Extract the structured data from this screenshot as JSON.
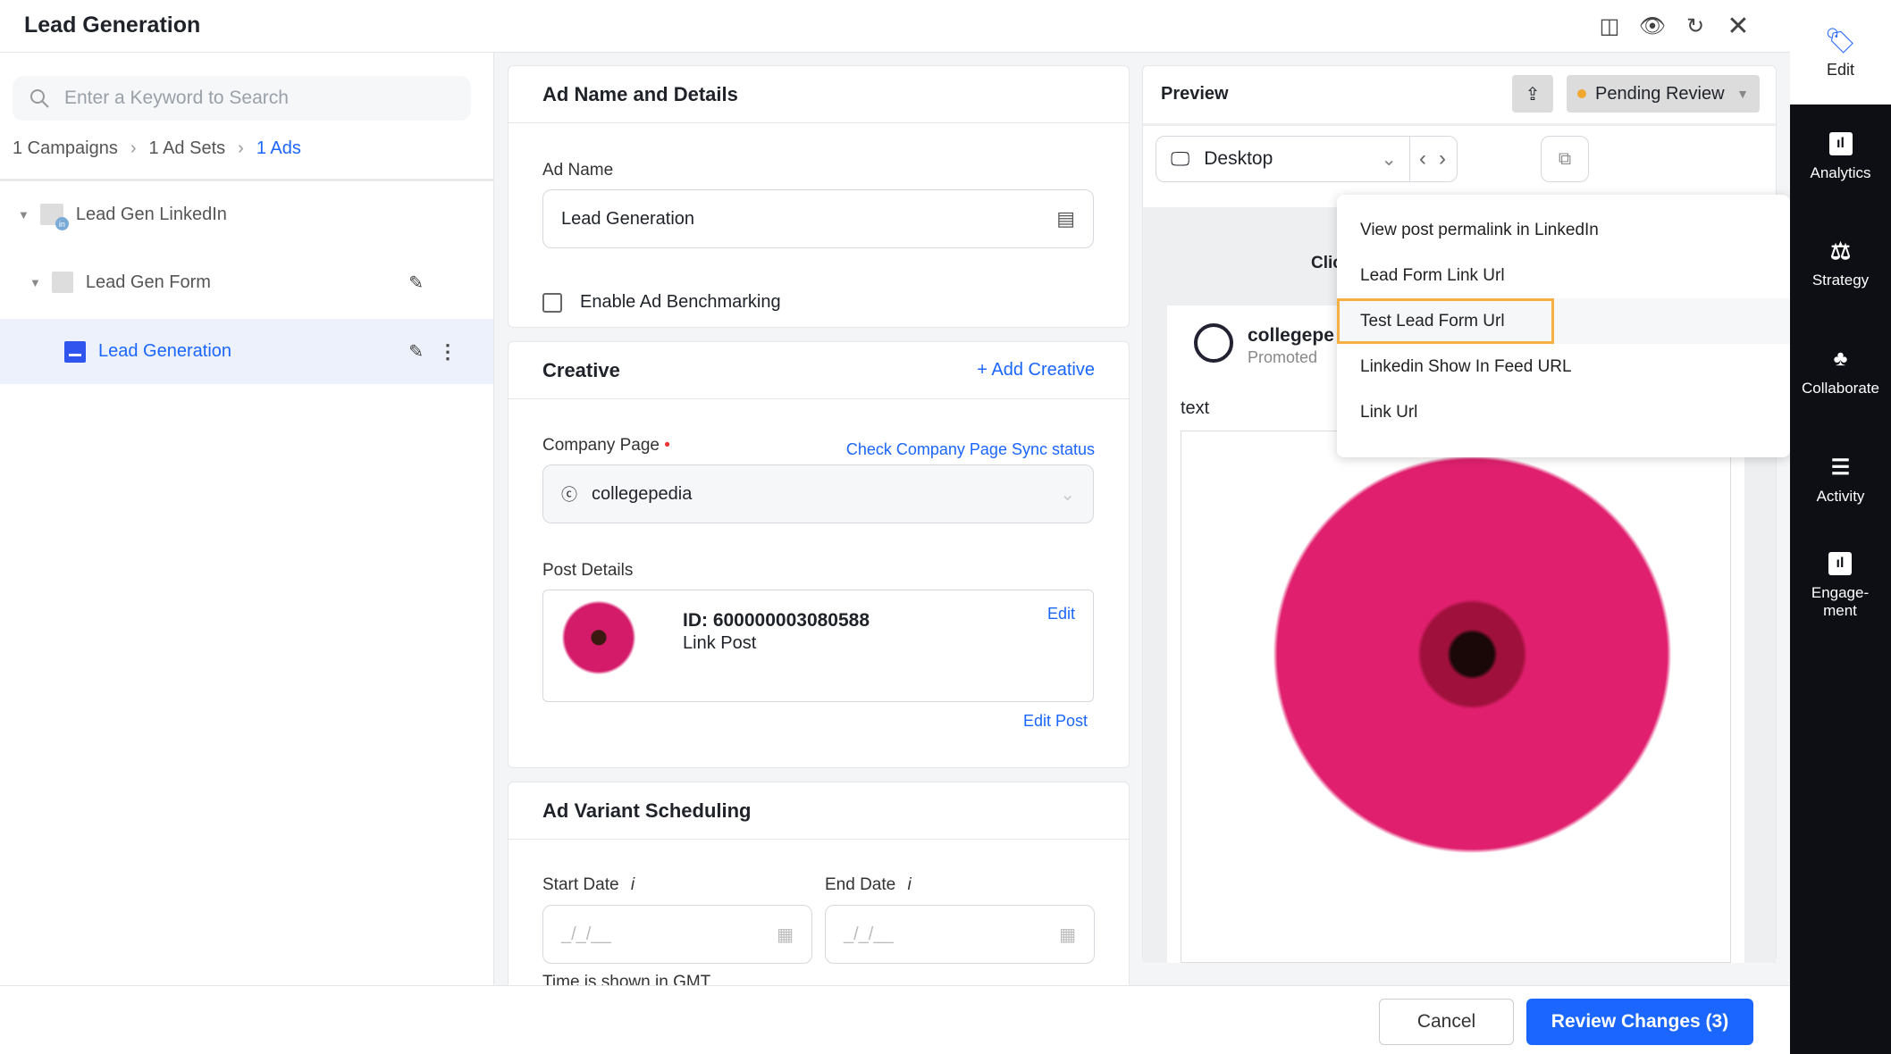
{
  "header": {
    "title": "Lead Generation",
    "icons": [
      "panel-icon",
      "eye-icon",
      "refresh-icon",
      "close-icon"
    ]
  },
  "left": {
    "search_placeholder": "Enter a Keyword to Search",
    "breadcrumb": [
      "1 Campaigns",
      "1 Ad Sets",
      "1 Ads"
    ],
    "tree": [
      {
        "label": "Lead Gen LinkedIn"
      },
      {
        "label": "Lead Gen Form"
      },
      {
        "label": "Lead Generation"
      }
    ]
  },
  "ad_details": {
    "title": "Ad Name and Details",
    "ad_name_label": "Ad Name",
    "ad_name_value": "Lead Generation",
    "benchmark_label": "Enable Ad Benchmarking",
    "benchmark_checked": false
  },
  "creative": {
    "title": "Creative",
    "add_label": "+ Add Creative",
    "company_label": "Company Page",
    "required_mark": "•",
    "sync_link": "Check Company Page Sync status",
    "company_value": "collegepedia",
    "post_label": "Post Details",
    "post_id": "ID: 600000003080588",
    "post_type": "Link Post",
    "edit_label": "Edit",
    "edit_post_label": "Edit Post"
  },
  "scheduling": {
    "title": "Ad Variant Scheduling",
    "start_label": "Start Date",
    "end_label": "End Date",
    "info": "i",
    "start_placeholder": "_/_/__",
    "end_placeholder": "_/_/__",
    "note": "Time is shown in GMT"
  },
  "preview": {
    "title": "Preview",
    "status": "Pending Review",
    "status_color": "#f0a830",
    "device": "Desktop",
    "cut_text": "Clic",
    "page_name": "collegepe",
    "promoted": "Promoted",
    "post_text": "text"
  },
  "menu": {
    "items": [
      "View post permalink in LinkedIn",
      "Lead Form Link Url",
      "Test Lead Form Url",
      "Linkedin Show In Feed URL",
      "Link Url"
    ],
    "highlighted": "Test Lead Form Url"
  },
  "rightbar": {
    "items": [
      {
        "label": "Edit",
        "icon": "tag-icon"
      },
      {
        "label": "Analytics",
        "icon": "bar-chart-icon"
      },
      {
        "label": "Strategy",
        "icon": "scale-icon"
      },
      {
        "label": "Collaborate",
        "icon": "people-icon"
      },
      {
        "label": "Activity",
        "icon": "timeline-icon"
      },
      {
        "label": "Engage-ment",
        "icon": "engagement-icon"
      }
    ]
  },
  "footer": {
    "cancel": "Cancel",
    "review": "Review Changes (3)"
  },
  "colors": {
    "accent": "#1a66ff",
    "dark_sidebar": "#0d0f14",
    "highlight": "#f5b041"
  }
}
